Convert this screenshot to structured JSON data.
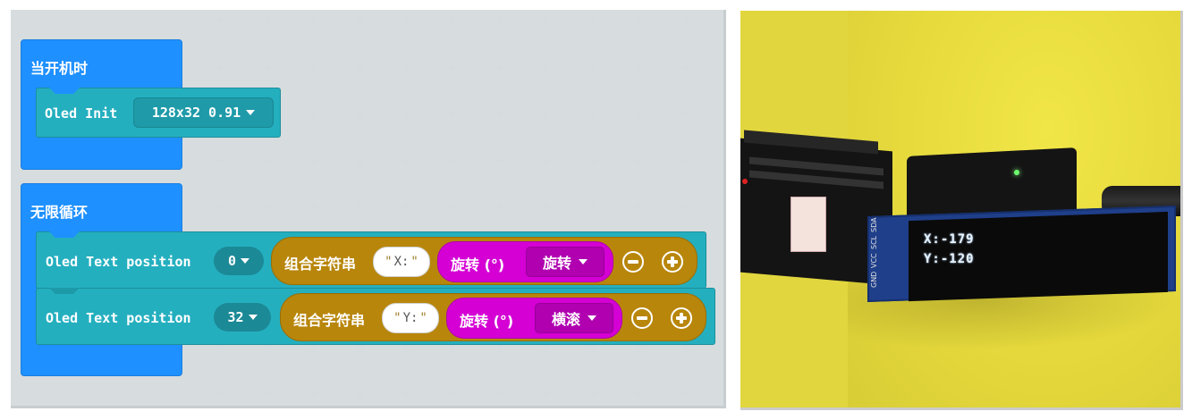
{
  "workspace": {
    "on_start_label": "当开机时",
    "oled_init": {
      "label": "Oled Init",
      "value": "128x32 0.91"
    },
    "forever_label": "无限循环",
    "rows": [
      {
        "label": "Oled Text position",
        "position_value": "0",
        "join_label": "组合字符串",
        "string_value": "X:",
        "rotation_label": "旋转 (°)",
        "rotation_option": "旋转"
      },
      {
        "label": "Oled Text position",
        "position_value": "32",
        "join_label": "组合字符串",
        "string_value": "Y:",
        "rotation_label": "旋转 (°)",
        "rotation_option": "横滚"
      }
    ]
  },
  "photo": {
    "oled_lines": [
      "X:-179",
      "Y:-120"
    ],
    "pin_labels": [
      "GND",
      "VCC",
      "SCL",
      "SDA"
    ]
  },
  "colors": {
    "event_block": "#1e90ff",
    "statement_block": "#24afbf",
    "join_block": "#b8860b",
    "rotation_block": "#d400d4",
    "photo_background": "#e2d63e"
  }
}
